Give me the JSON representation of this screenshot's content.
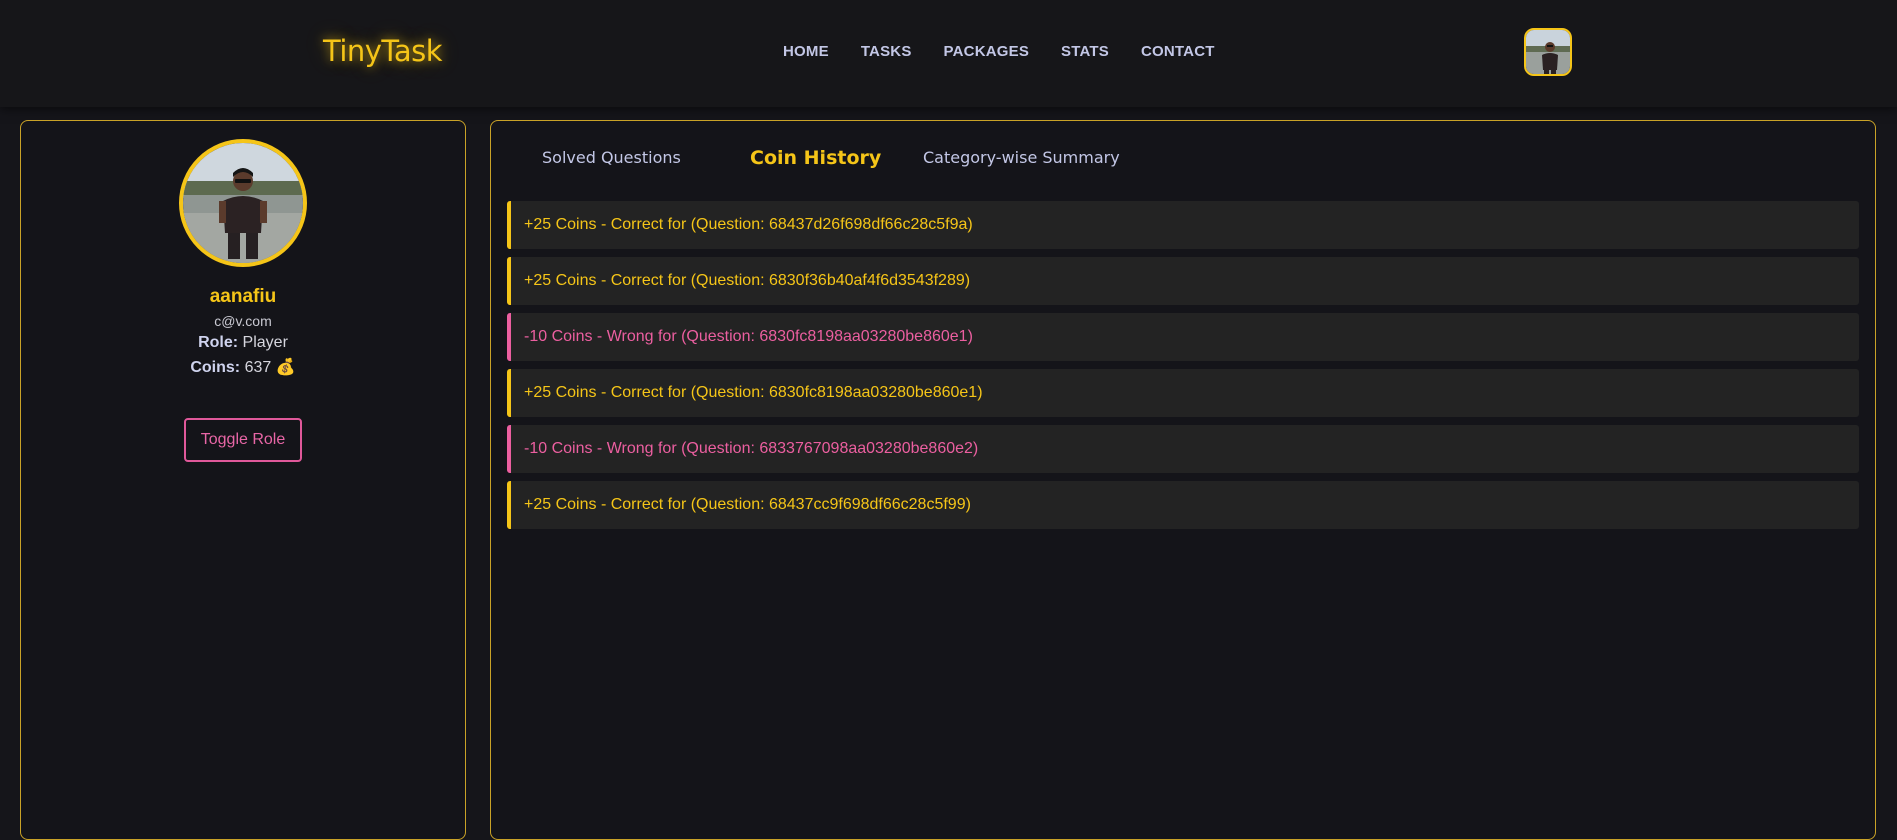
{
  "app": {
    "logo": "TinyTask",
    "nav": [
      "HOME",
      "TASKS",
      "PACKAGES",
      "STATS",
      "CONTACT"
    ]
  },
  "profile": {
    "username": "aanafiu",
    "email": "c@v.com",
    "role_label": "Role:",
    "role": "Player",
    "coins_label": "Coins:",
    "coins": "637",
    "coin_icon": "💰",
    "toggle_role_label": "Toggle Role"
  },
  "tabs": {
    "solved": "Solved Questions",
    "coin_history": "Coin History",
    "category_summary": "Category-wise Summary",
    "active": "Coin History"
  },
  "coin_history": [
    {
      "text": "+25 Coins - Correct for (Question: 68437d26f698df66c28c5f9a)",
      "type": "positive"
    },
    {
      "text": "+25 Coins - Correct for (Question: 6830f36b40af4f6d3543f289)",
      "type": "positive"
    },
    {
      "text": "-10 Coins - Wrong for (Question: 6830fc8198aa03280be860e1)",
      "type": "negative"
    },
    {
      "text": "+25 Coins - Correct for (Question: 6830fc8198aa03280be860e1)",
      "type": "positive"
    },
    {
      "text": "-10 Coins - Wrong for (Question: 6833767098aa03280be860e2)",
      "type": "negative"
    },
    {
      "text": "+25 Coins - Correct for (Question: 68437cc9f698df66c28c5f99)",
      "type": "positive"
    }
  ],
  "colors": {
    "accent": "#f5c518",
    "negative": "#ec5fa0",
    "background": "#15151a",
    "card": "#232323"
  }
}
